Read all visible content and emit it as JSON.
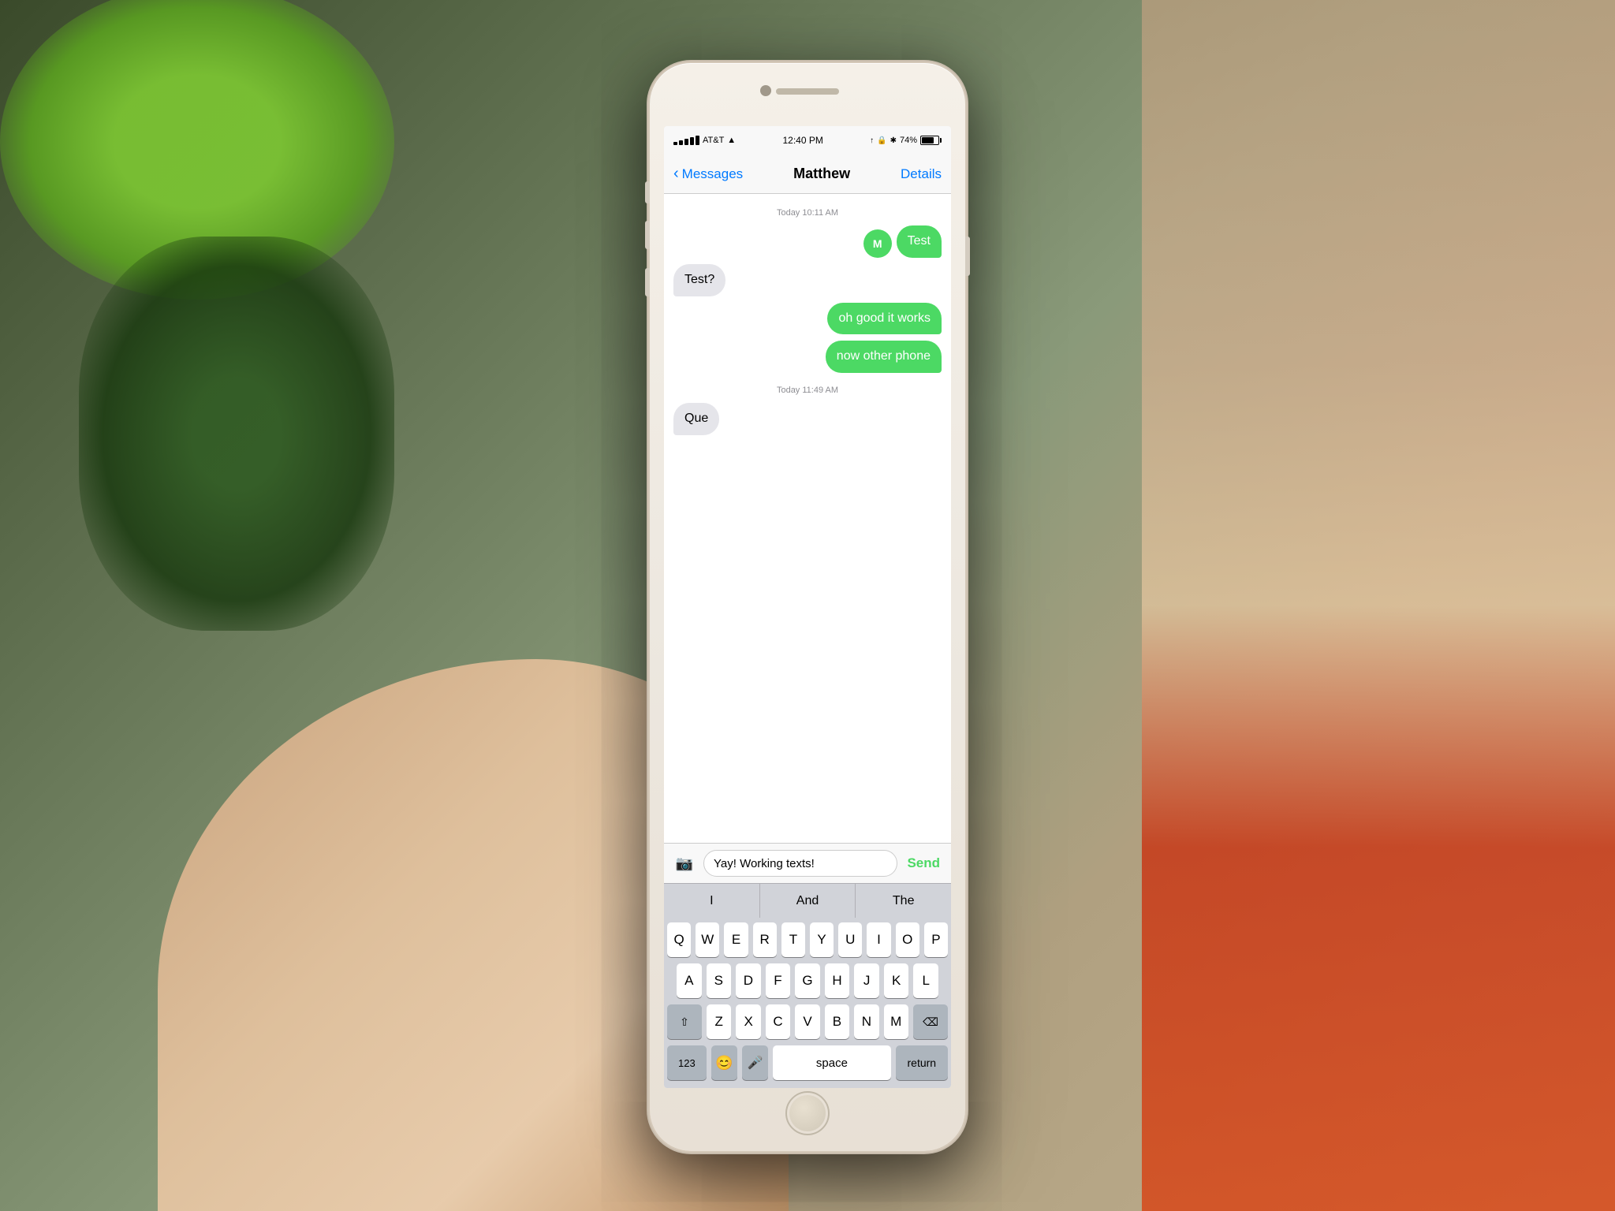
{
  "background": {
    "description": "Blurred desk scene with Android figurine, plant, and hand holding iPhone"
  },
  "status_bar": {
    "carrier": "AT&T",
    "signal": "●●●●●",
    "wifi": "wifi",
    "time": "12:40 PM",
    "battery_percent": "74%",
    "icons": [
      "signal",
      "lock",
      "bluetooth",
      "wifi"
    ]
  },
  "nav": {
    "back_label": "Messages",
    "title": "Matthew",
    "details_label": "Details"
  },
  "messages": [
    {
      "type": "timestamp",
      "text": "Today 10:11 AM"
    },
    {
      "type": "outgoing",
      "text": "Test",
      "show_avatar": true
    },
    {
      "type": "incoming",
      "text": "Test?"
    },
    {
      "type": "outgoing",
      "text": "oh good it works"
    },
    {
      "type": "outgoing",
      "text": "now other phone"
    },
    {
      "type": "timestamp",
      "text": "Today 11:49 AM"
    },
    {
      "type": "incoming",
      "text": "Que"
    }
  ],
  "input": {
    "text": "Yay! Working texts!",
    "send_label": "Send",
    "camera_icon": "📷"
  },
  "autocomplete": {
    "suggestions": [
      "I",
      "And",
      "The"
    ]
  },
  "keyboard": {
    "rows": [
      [
        "Q",
        "W",
        "E",
        "R",
        "T",
        "Y",
        "U",
        "I",
        "O",
        "P"
      ],
      [
        "A",
        "S",
        "D",
        "F",
        "G",
        "H",
        "J",
        "K",
        "L"
      ],
      [
        "⇧",
        "Z",
        "X",
        "C",
        "V",
        "B",
        "N",
        "M",
        "⌫"
      ],
      [
        "123",
        "😊",
        "🎤",
        "space",
        "return"
      ]
    ],
    "special_bottom": [
      "123",
      "emoji",
      "mic",
      "space",
      "return"
    ]
  }
}
